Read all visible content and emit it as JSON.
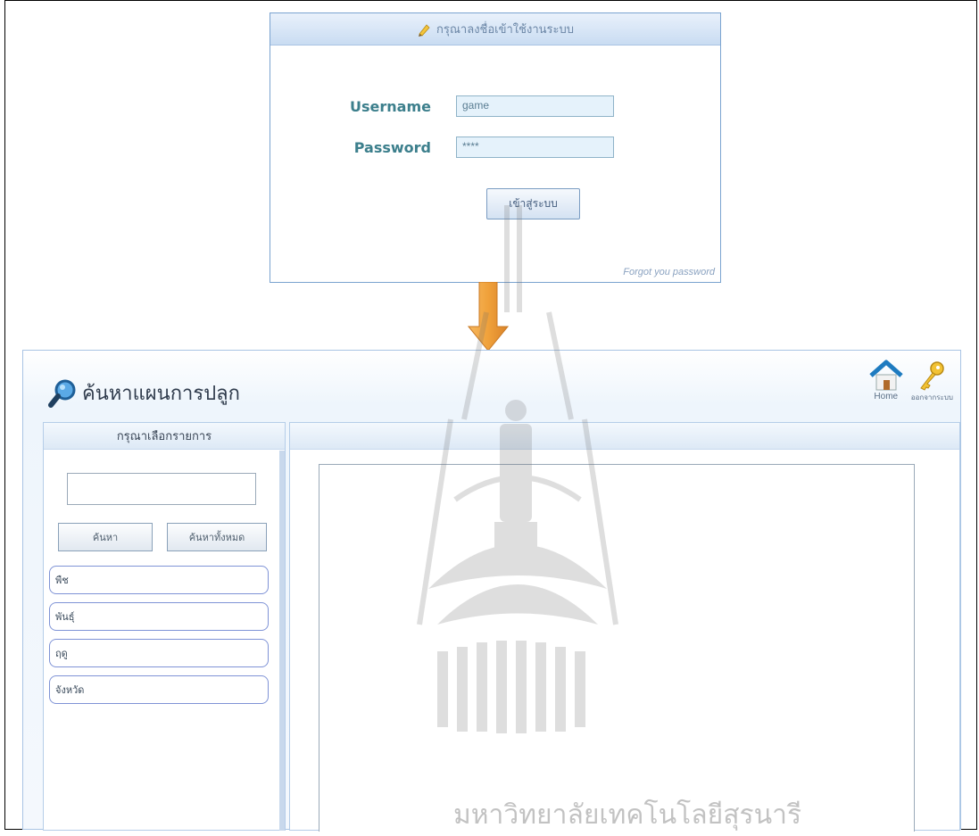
{
  "login": {
    "title": "กรุณาลงชื่อเข้าใช้งานระบบ",
    "username_label": "Username",
    "username_value": "game",
    "password_label": "Password",
    "password_value": "****",
    "submit_label": "เข้าสู่ระบบ",
    "forgot_label": "Forgot you password"
  },
  "app": {
    "title": "ค้นหาแผนการปลูก",
    "home_label": "Home",
    "logout_label": "ออกจากระบบ",
    "sidebar": {
      "header": "กรุณาเลือกรายการ",
      "search_value": "",
      "search_button": "ค้นหา",
      "search_all_button": "ค้นหาทั้งหมด",
      "items": [
        {
          "label": "พืช"
        },
        {
          "label": "พันธุ์"
        },
        {
          "label": "ฤดู"
        },
        {
          "label": "จังหวัด"
        }
      ]
    }
  },
  "watermark": {
    "text": "มหาวิทยาลัยเทคโนโลยีสุรนารี"
  },
  "colors": {
    "accent": "#3c7f8c",
    "header_blue": "#c9dcf2",
    "arrow_orange": "#f0a13a"
  }
}
